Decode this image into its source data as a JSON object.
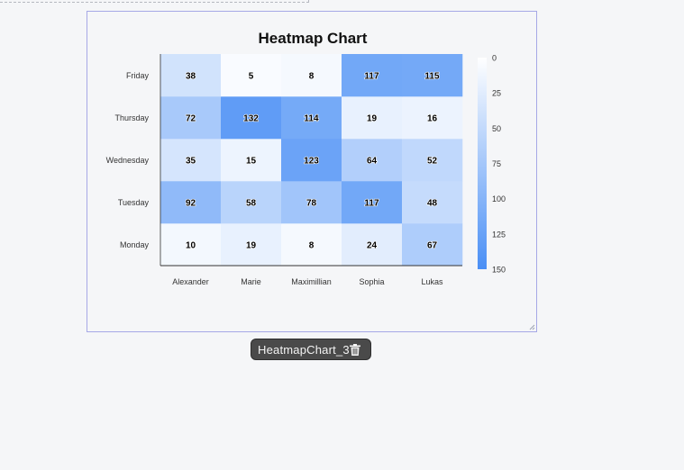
{
  "widget": {
    "name": "HeatmapChart_3"
  },
  "colors": {
    "low": "#ffffff",
    "high": "#4a8ff5",
    "cell_text": "#000000"
  },
  "chart_data": {
    "type": "heatmap",
    "title": "Heatmap Chart",
    "x_categories": [
      "Alexander",
      "Marie",
      "Maximillian",
      "Sophia",
      "Lukas"
    ],
    "y_categories": [
      "Monday",
      "Tuesday",
      "Wednesday",
      "Thursday",
      "Friday"
    ],
    "values": [
      [
        10,
        19,
        8,
        24,
        67
      ],
      [
        92,
        58,
        78,
        117,
        48
      ],
      [
        35,
        15,
        123,
        64,
        52
      ],
      [
        72,
        132,
        114,
        19,
        16
      ],
      [
        38,
        5,
        8,
        117,
        115
      ]
    ],
    "color_scale": {
      "min": 0,
      "max": 150,
      "ticks": [
        0,
        25,
        50,
        75,
        100,
        125,
        150
      ]
    },
    "legend_position": "right"
  }
}
